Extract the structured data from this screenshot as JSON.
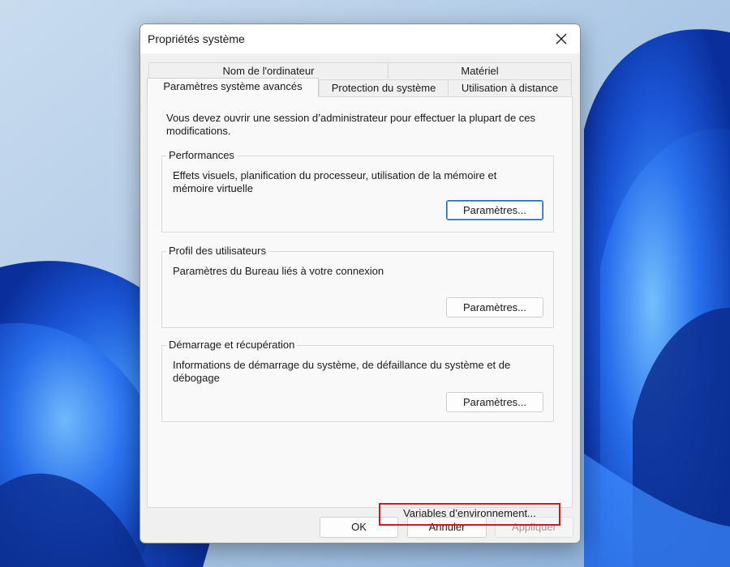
{
  "dialog": {
    "title": "Propriétés système",
    "close_icon": "close-icon"
  },
  "tabs": {
    "top_row": [
      {
        "label": "Nom de l'ordinateur"
      },
      {
        "label": "Matériel"
      }
    ],
    "bottom_row": [
      {
        "label": "Paramètres système avancés",
        "active": true
      },
      {
        "label": "Protection du système"
      },
      {
        "label": "Utilisation à distance"
      }
    ]
  },
  "panel": {
    "intro": "Vous devez ouvrir une session d’administrateur pour effectuer la plupart de ces modifications.",
    "performance": {
      "legend": "Performances",
      "description": "Effets visuels, planification du processeur, utilisation de la mémoire et mémoire virtuelle",
      "button": "Paramètres..."
    },
    "user_profiles": {
      "legend": "Profil des utilisateurs",
      "description": "Paramètres du Bureau liés à votre connexion",
      "button": "Paramètres..."
    },
    "startup_recovery": {
      "legend": "Démarrage et récupération",
      "description": "Informations de démarrage du système, de défaillance du système et de débogage",
      "button": "Paramètres..."
    },
    "env_variables_button": "Variables d’environnement...",
    "highlight_color": "#d4161d"
  },
  "footer": {
    "ok": "OK",
    "cancel": "Annuler",
    "apply": "Appliquer"
  },
  "colors": {
    "accent_focus": "#1b6ab5",
    "wallpaper_blue": "#1f5fd6"
  }
}
